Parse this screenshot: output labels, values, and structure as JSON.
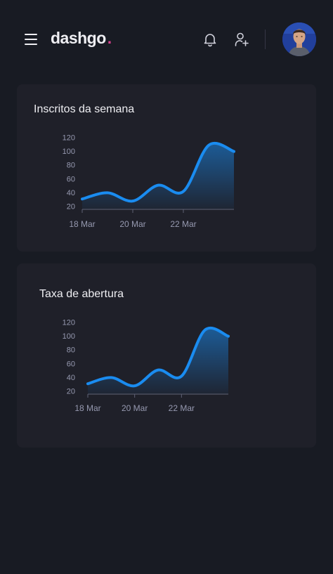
{
  "header": {
    "logo_text": "dashgo",
    "logo_dot": ".",
    "menu_icon": "hamburger-menu-icon",
    "notification_icon": "bell-icon",
    "add_user_icon": "user-plus-icon",
    "avatar_icon": "user-avatar-photo"
  },
  "colors": {
    "background": "#181b23",
    "card": "#1f2029",
    "accent": "#d53f8c",
    "line": "#1a8cf0",
    "axis_text": "#9699b0"
  },
  "charts": [
    {
      "title": "Inscritos da semana",
      "chart_data": {
        "type": "area",
        "x": [
          "2021-03-18",
          "2021-03-19",
          "2021-03-20",
          "2021-03-21",
          "2021-03-22",
          "2021-03-23",
          "2021-03-24"
        ],
        "values": [
          31,
          40,
          28,
          51,
          42,
          109,
          100
        ],
        "xticks": [
          "18 Mar",
          "20 Mar",
          "22 Mar"
        ],
        "yticks": [
          "120",
          "100",
          "80",
          "60",
          "40",
          "20"
        ],
        "ylim": [
          20,
          120
        ],
        "grid": false
      }
    },
    {
      "title": "Taxa de abertura",
      "chart_data": {
        "type": "area",
        "x": [
          "2021-03-18",
          "2021-03-19",
          "2021-03-20",
          "2021-03-21",
          "2021-03-22",
          "2021-03-23",
          "2021-03-24"
        ],
        "values": [
          31,
          40,
          28,
          51,
          42,
          109,
          100
        ],
        "xticks": [
          "18 Mar",
          "20 Mar",
          "22 Mar"
        ],
        "yticks": [
          "120",
          "100",
          "80",
          "60",
          "40",
          "20"
        ],
        "ylim": [
          20,
          120
        ],
        "grid": false
      }
    }
  ]
}
